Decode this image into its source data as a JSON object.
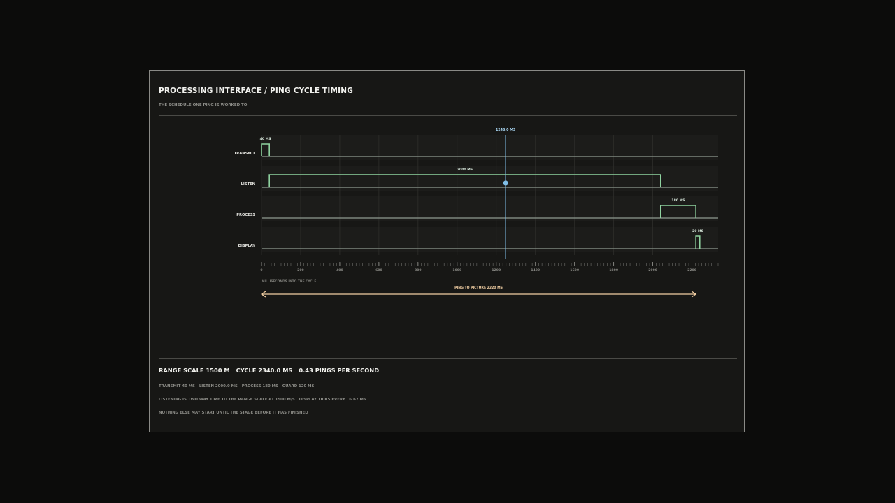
{
  "header": {
    "title": "PROCESSING INTERFACE / PING CYCLE TIMING",
    "subtitle": "THE SCHEDULE ONE PING IS WORKED TO"
  },
  "chart_data": {
    "type": "timing",
    "x_min": 0,
    "x_max": 2340,
    "x_ticks": [
      0,
      200,
      400,
      600,
      800,
      1000,
      1200,
      1400,
      1600,
      1800,
      2000,
      2200
    ],
    "minor_tick_step": 16.67,
    "xlabel": "MILLISECONDS INTO THE CYCLE",
    "lanes": [
      {
        "name": "TRANSMIT",
        "start": 0,
        "end": 40,
        "label": "40 MS"
      },
      {
        "name": "LISTEN",
        "start": 40,
        "end": 2040,
        "label": "2000 MS"
      },
      {
        "name": "PROCESS",
        "start": 2040,
        "end": 2220,
        "label": "180 MS"
      },
      {
        "name": "DISPLAY",
        "start": 2220,
        "end": 2240,
        "label": "20 MS"
      }
    ],
    "cursor": {
      "x": 1248,
      "label": "1248.0 MS",
      "lane": "LISTEN"
    },
    "span": {
      "start": 0,
      "end": 2220,
      "label": "PING TO PICTURE 2220 MS"
    },
    "colors": {
      "signal": "#8fd3a0",
      "baseline": "#8e9a90",
      "cursor": "#7fbde6",
      "span": "#f2cfa3",
      "grid": "#2e2e2b",
      "lane_bg": "#1c1c1a",
      "tick": "#6f6f6b"
    }
  },
  "summary": {
    "range_scale": "RANGE SCALE 1500 M",
    "cycle": "CYCLE 2340.0 MS",
    "rate": "0.43 PINGS PER SECOND",
    "transmit": "TRANSMIT 40 MS",
    "listen": "LISTEN 2000.0 MS",
    "process": "PROCESS 180 MS",
    "guard": "GUARD 120 MS",
    "note_listening": "LISTENING IS TWO WAY TIME TO THE RANGE SCALE AT 1500 M/S",
    "note_display": "DISPLAY TICKS EVERY 16.67 MS",
    "note_order": "NOTHING ELSE MAY START UNTIL THE STAGE BEFORE IT HAS FINISHED"
  }
}
